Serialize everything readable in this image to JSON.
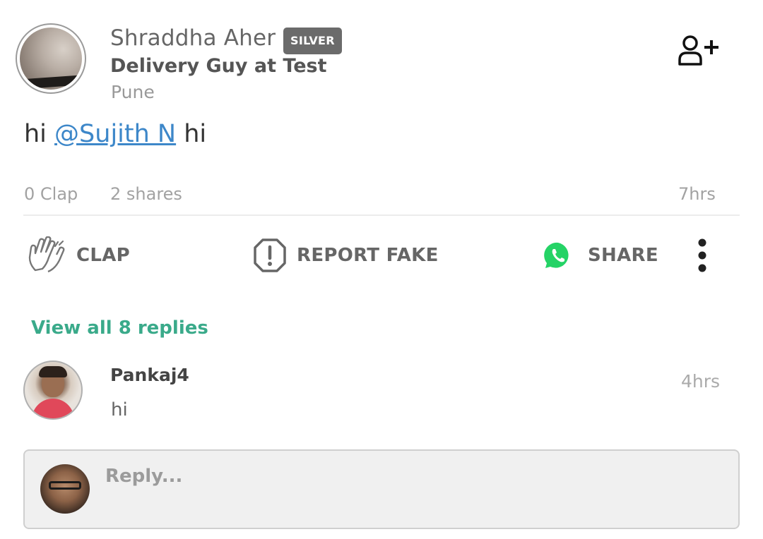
{
  "post": {
    "author": {
      "name": "Shraddha Aher",
      "badge": "SILVER",
      "title": "Delivery Guy at Test",
      "location": "Pune"
    },
    "content": {
      "prefix": "hi ",
      "mention": "@Sujith N",
      "suffix": " hi"
    },
    "stats": {
      "claps": "0 Clap",
      "shares": "2 shares",
      "time": "7hrs"
    },
    "actions": {
      "clap": "CLAP",
      "report": "REPORT FAKE",
      "share": "SHARE"
    }
  },
  "replies": {
    "view_all": "View all 8 replies",
    "items": [
      {
        "name": "Pankaj4",
        "text": "hi",
        "time": "4hrs"
      }
    ]
  },
  "reply_input": {
    "placeholder": "Reply..."
  },
  "icons": {
    "follow": "add-user-icon",
    "clap": "clap-hands-icon",
    "report": "exclamation-octagon-icon",
    "share": "whatsapp-icon",
    "more": "more-vertical-icon"
  },
  "colors": {
    "mention": "#3d87c9",
    "view_all": "#3aaa8a",
    "whatsapp": "#25d366",
    "badge_bg": "#6b6b6b"
  }
}
